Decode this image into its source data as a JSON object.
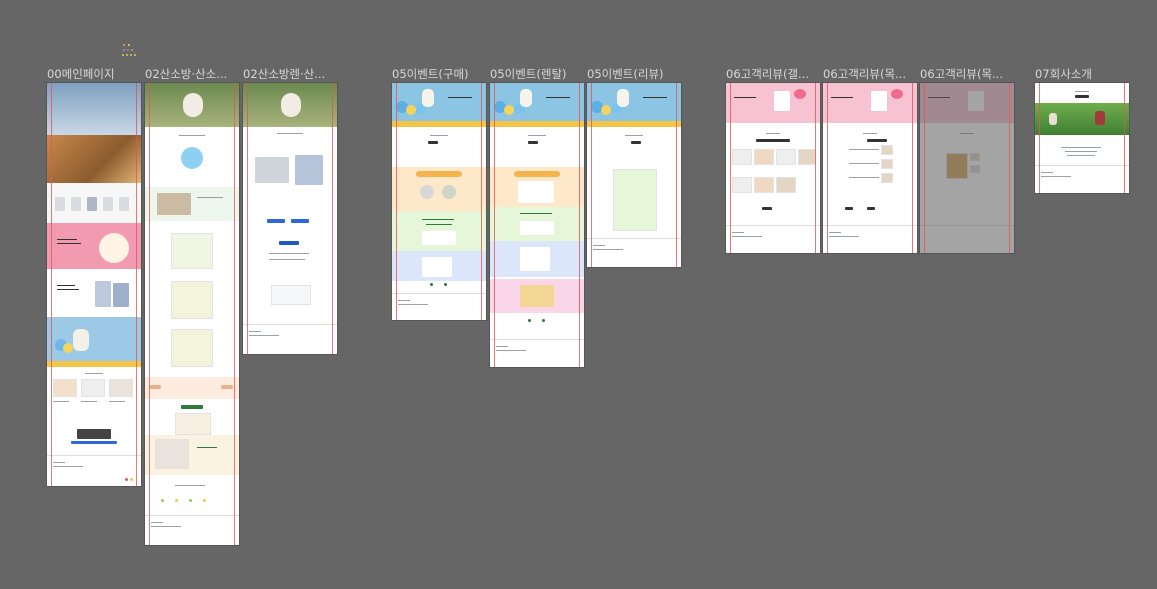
{
  "canvas": {
    "background": "#666666"
  },
  "artboards": [
    {
      "id": "main",
      "label": "00메인페이지"
    },
    {
      "id": "sanso-room",
      "label": "02산소방·산소..."
    },
    {
      "id": "sanso-rental",
      "label": "02산소방렌·산..."
    },
    {
      "id": "event-buy",
      "label": "05이벤트(구매)"
    },
    {
      "id": "event-rental",
      "label": "05이벤트(렌탈)"
    },
    {
      "id": "event-review",
      "label": "05이벤트(리뷰)"
    },
    {
      "id": "review-gallery",
      "label": "06고객리뷰(갤..."
    },
    {
      "id": "review-list",
      "label": "06고객리뷰(목..."
    },
    {
      "id": "review-list2",
      "label": "06고객리뷰(목..."
    },
    {
      "id": "company",
      "label": "07회사소개"
    }
  ],
  "colors": {
    "sky": "#8cc5e3",
    "yellow": "#f3c64a",
    "pink": "#f08aa3",
    "green_soft": "#e6f6d8",
    "orange_soft": "#fde8c9",
    "blue_soft": "#dbe6fb",
    "review_pink": "#f7c3d2",
    "guide": "#e25555"
  }
}
